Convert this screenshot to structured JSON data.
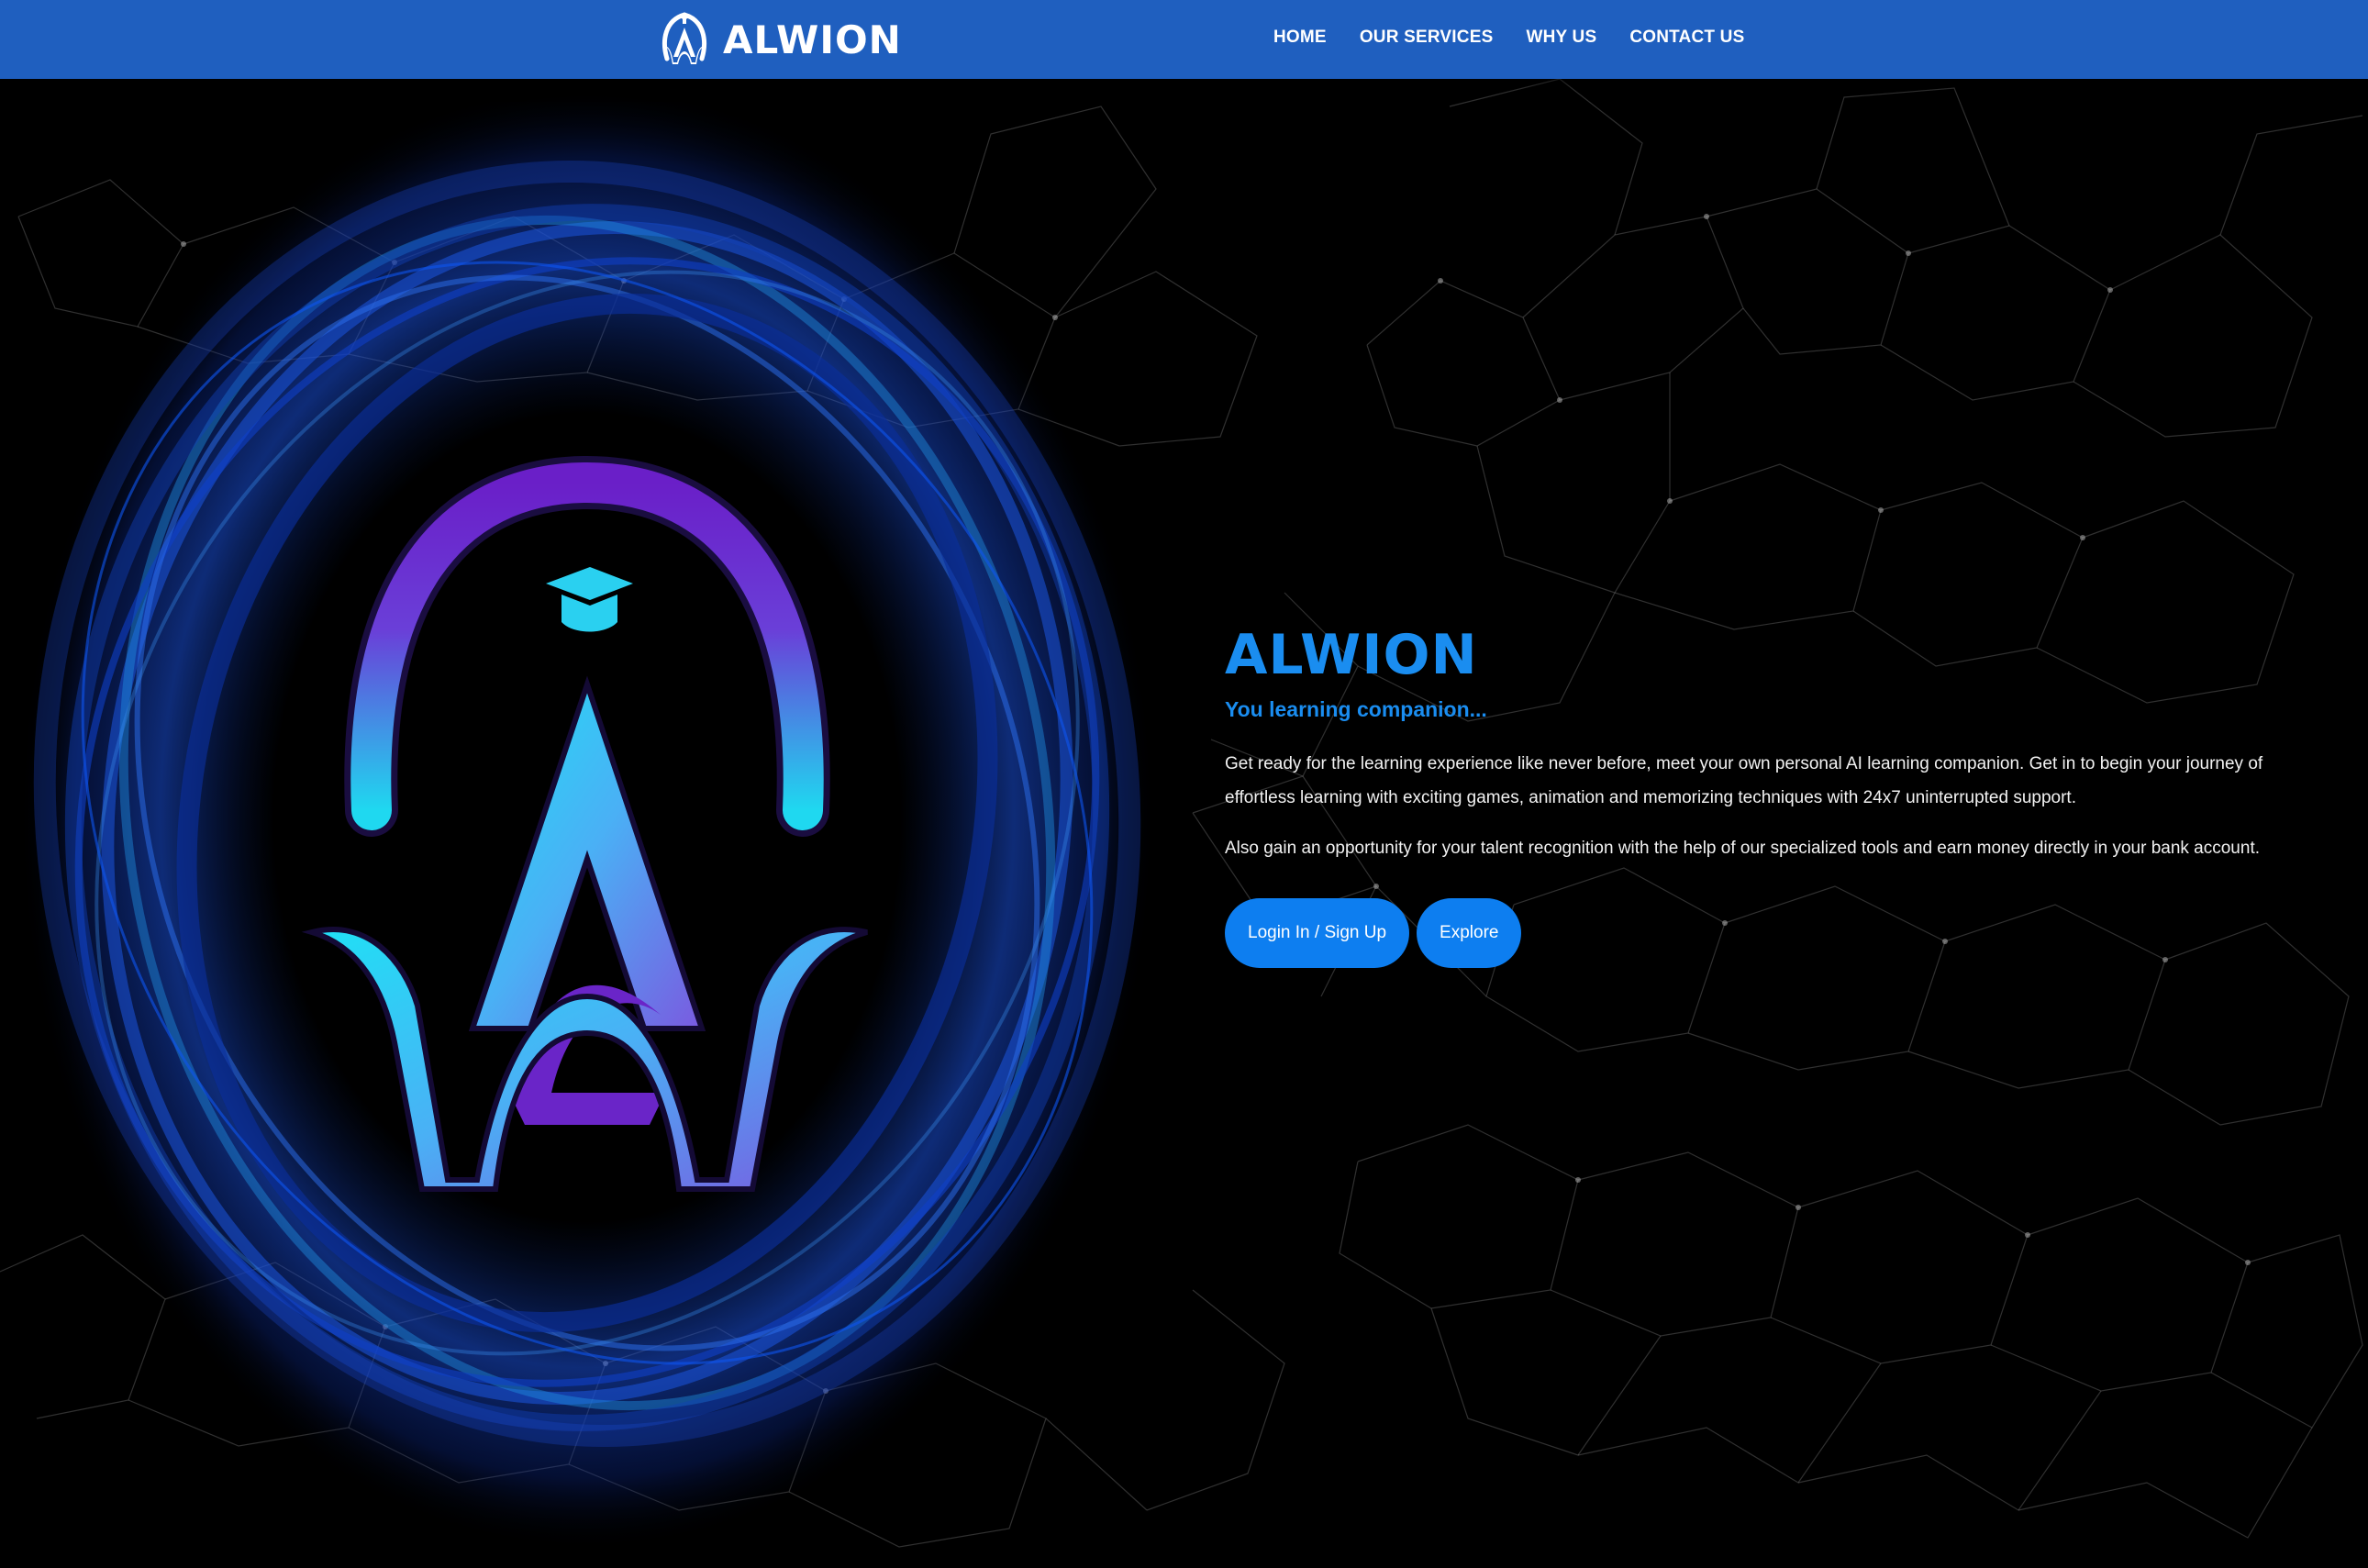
{
  "header": {
    "brand": "ALWION",
    "nav": [
      "HOME",
      "OUR SERVICES",
      "WHY US",
      "CONTACT US"
    ]
  },
  "hero": {
    "title": "ALWION",
    "subtitle": "You learning companion...",
    "paragraph1": "Get ready for the learning experience like never before, meet your own personal AI learning companion. Get in to begin your journey of effortless learning with exciting games, animation and memorizing techniques with 24x7 uninterrupted support.",
    "paragraph2": "Also gain an opportunity for your talent recognition with the help of our specialized tools and earn money directly in your bank account.",
    "buttons": {
      "login": "Login In / Sign Up",
      "explore": "Explore"
    }
  },
  "colors": {
    "header_bg": "#1f5fbf",
    "accent": "#1a8df0",
    "button": "#0d7ef0",
    "background": "#000000"
  },
  "icons": [
    "alwion-logo-icon",
    "alwion-emblem",
    "network-background"
  ]
}
